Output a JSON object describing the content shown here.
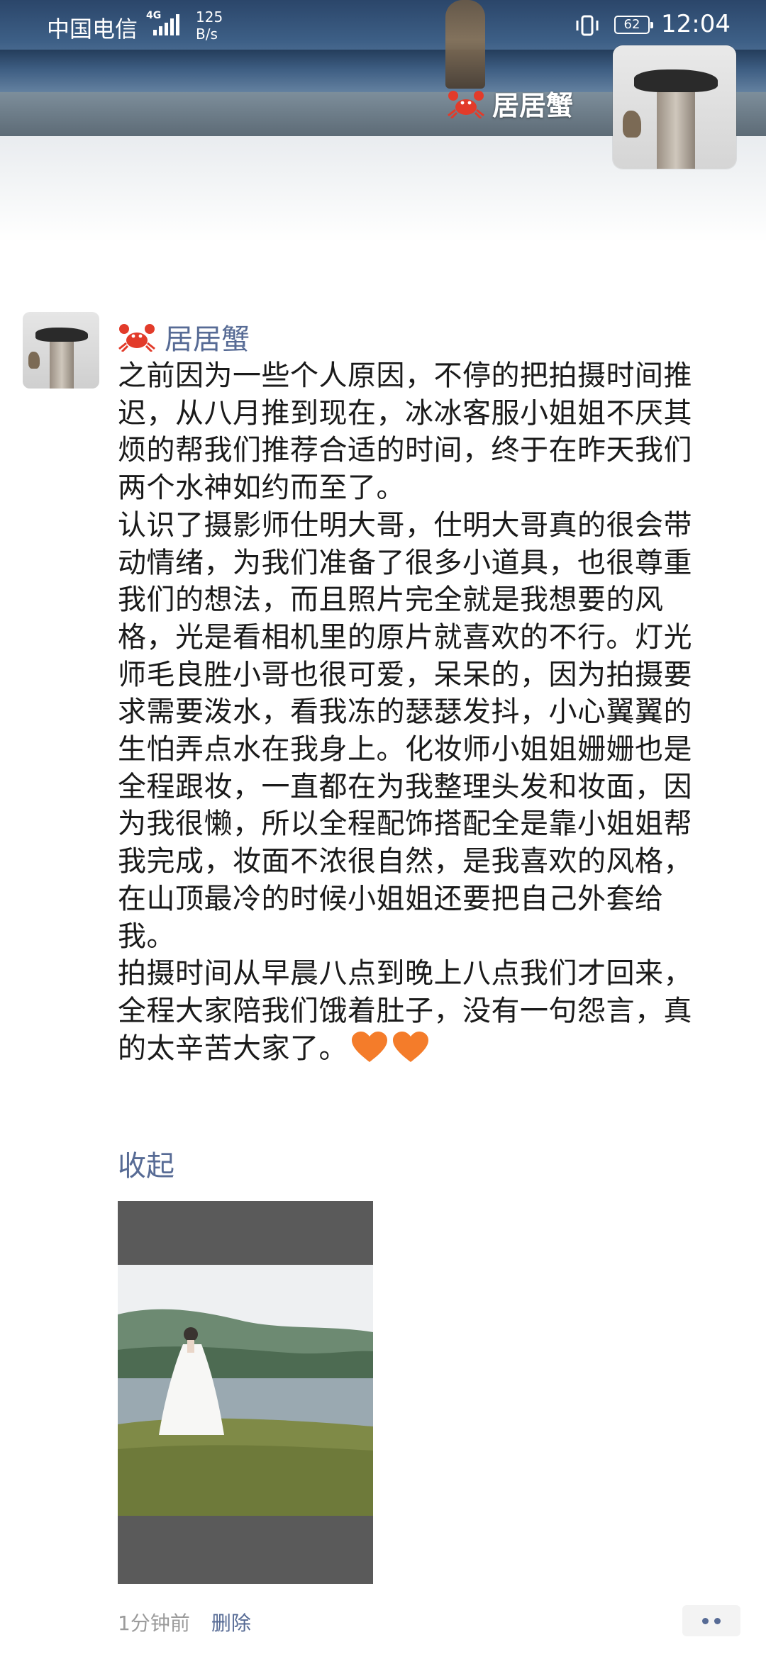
{
  "status_bar": {
    "carrier": "中国电信",
    "network": "4G",
    "speed_value": "125",
    "speed_unit": "B/s",
    "battery": "62",
    "time": "12:04"
  },
  "cover": {
    "name": "居居蟹"
  },
  "post": {
    "author": "居居蟹",
    "paragraphs": [
      "之前因为一些个人原因，不停的把拍摄时间推迟，从八月推到现在，冰冰客服小姐姐不厌其烦的帮我们推荐合适的时间，终于在昨天我们两个水神如约而至了。",
      "认识了摄影师仕明大哥，仕明大哥真的很会带动情绪，为我们准备了很多小道具，也很尊重我们的想法，而且照片完全就是我想要的风格，光是看相机里的原片就喜欢的不行。灯光师毛良胜小哥也很可爱，呆呆的，因为拍摄要求需要泼水，看我冻的瑟瑟发抖，小心翼翼的生怕弄点水在我身上。化妆师小姐姐姗姗也是全程跟妆，一直都在为我整理头发和妆面，因为我很懒，所以全程配饰搭配全是靠小姐姐帮我完成，妆面不浓很自然，是我喜欢的风格，在山顶最冷的时候小姐姐还要把自己外套给我。",
      "拍摄时间从早晨八点到晚上八点我们才回来，全程大家陪我们饿着肚子，没有一句怨言，真的太辛苦大家了。"
    ],
    "heart_icon": "orange-heart",
    "heart_color": "#f47c2a",
    "collapse_label": "收起",
    "time_ago": "1分钟前",
    "delete_label": "删除"
  },
  "colors": {
    "link_blue": "#576b95",
    "text": "#1a1a1a",
    "meta_gray": "#9b9b9b"
  }
}
